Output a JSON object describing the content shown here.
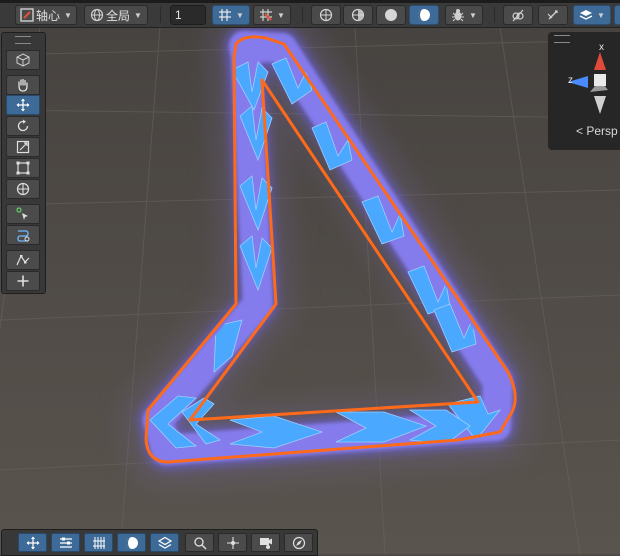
{
  "toolbar": {
    "pivot_label": "轴心",
    "space_label": "全局",
    "snap_increment": "1"
  },
  "gizmo": {
    "axis_x": "x",
    "axis_z": "z",
    "projection_label": "Persp"
  },
  "tools": [
    "view-cube",
    "hand",
    "move",
    "rotate",
    "scale",
    "rect",
    "transform",
    "edit-vertices",
    "edit-path",
    "sculpt",
    "add"
  ],
  "colors": {
    "scene_background": "#4f4a45",
    "outline": "#ff6a1a",
    "arrow_fill": "#4aa8ff",
    "glow": "#7c72ff",
    "active_tool": "#3d6a96",
    "gizmo_y": "#e04a3a",
    "gizmo_x": "#4a8cff"
  }
}
